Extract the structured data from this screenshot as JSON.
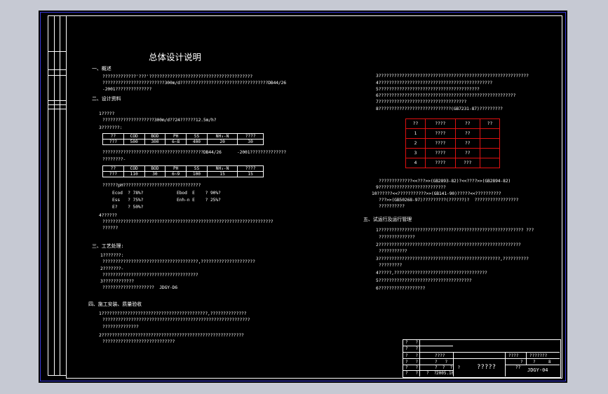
{
  "title": "总体设计说明",
  "sections": {
    "s1_heading": "一、概述",
    "s1_lines": [
      "?????????????'???'????????????????????????????????????????",
      "????????????????????????300m/d??????????????????????????????????DB44/26",
      "-2001??????????????"
    ],
    "s2_heading": "二、设计资料",
    "s2_lines_a": [
      "1?????",
      "????????????????????300m/d??24??????12.5m/h?",
      "3???????:"
    ],
    "table1": {
      "header": [
        "??",
        "COD",
        "BOD",
        "PH",
        "SS",
        "NH₃-N",
        "????"
      ],
      "row": [
        "???",
        "500",
        "300",
        "6~8",
        "400",
        "20",
        "30"
      ]
    },
    "s2_lines_b": [
      "???????????????????????????????????????DB44/26      -2001??????????????",
      "????????-"
    ],
    "table2": {
      "header": [
        "??",
        "COD",
        "BOD",
        "PH",
        "SS",
        "NH₃-N",
        "????"
      ],
      "row": [
        "???",
        "110",
        "30",
        "6~9",
        "100",
        "15",
        "15"
      ]
    },
    "s2_lines_c": [
      "??????pH??????????????????????????????"
    ],
    "eff_left": [
      "Ecod  ? 78%?",
      "Ess   ? 75%?",
      "E?    ? 50%?"
    ],
    "eff_right": [
      "Ebod  E    ? 90%?",
      "Enh-n E    ? 25%?"
    ],
    "s2_lines_d": [
      "4??????",
      "??????????????????????????????????????????????????????????????????",
      "??????"
    ],
    "s3_heading": "三、工艺处理:",
    "s3_lines": [
      "1???????:",
      "?????????????????????????????????????,?????????????????????",
      "2???????-",
      "?????????????????????????????????????",
      "3????????????",
      "????????????????????  JDGY-D6"
    ],
    "s4_heading": "四、施工安装、质量验收",
    "s4_lines": [
      "1?????????????????????????????????????????,??????????????",
      "?????????????????????????????????????????????????????????",
      "??????????????",
      "2???????????????????????????????????????????????????????",
      "????????????????????????????"
    ],
    "right_lines_a": [
      "3??????????????????????????????????????????????????????????",
      "4????????????????????????????????????????????",
      "5???????????????????????????????????????",
      "6?????????????????????????????????????????????????????",
      "7??????????????????????????????????",
      "8????????????????????????????(GB7231-87)?????????"
    ],
    "red_table": [
      [
        "??",
        "????",
        "??",
        "??"
      ],
      [
        "1",
        "????",
        "??",
        ""
      ],
      [
        "2",
        "????",
        "??",
        ""
      ],
      [
        "3",
        "????",
        "??",
        ""
      ],
      [
        "4",
        "????",
        "???",
        ""
      ]
    ],
    "right_lines_b": [
      "?????????????<<???>>(GB2893-82)?<<????>>(GB2894-82)",
      "9??????????????????????????",
      "10??????<<???????????>>(GB141-90)?????<<??????????",
      "???>>(GB50268-97)?????????(??????)?  ?????????????????",
      "??????????"
    ],
    "s5_heading": "五、试运行及运行管理",
    "s5_lines": [
      "1???????????????????????????????????????????????????????? ???",
      "??????????????",
      "2???????????????????????????????????????????????????????",
      "???????????",
      "3???????????????????????????????????????????????,??????????",
      "?????????",
      "4?????,????????????????????????????????????",
      "5????????????????????????????????????",
      "6??????????????????"
    ]
  },
  "titleblock": {
    "r1": "?   ?",
    "r2": "?   ?",
    "r3a": "?   ?",
    "r3b": "????",
    "r3c": "????",
    "r3d": "???????",
    "r4a": "?   ?",
    "r4b": "?   ?",
    "r4c": "?",
    "r4d": "?",
    "r4e": "8",
    "r5a": "?   ?",
    "r5b": "?  ?  ?  ?",
    "drawing_name": "?????",
    "r6a": "?   ?",
    "r6b": "?  ?",
    "date": "2005.10",
    "r6c": "??",
    "drawing_no": "JDGY-04"
  }
}
